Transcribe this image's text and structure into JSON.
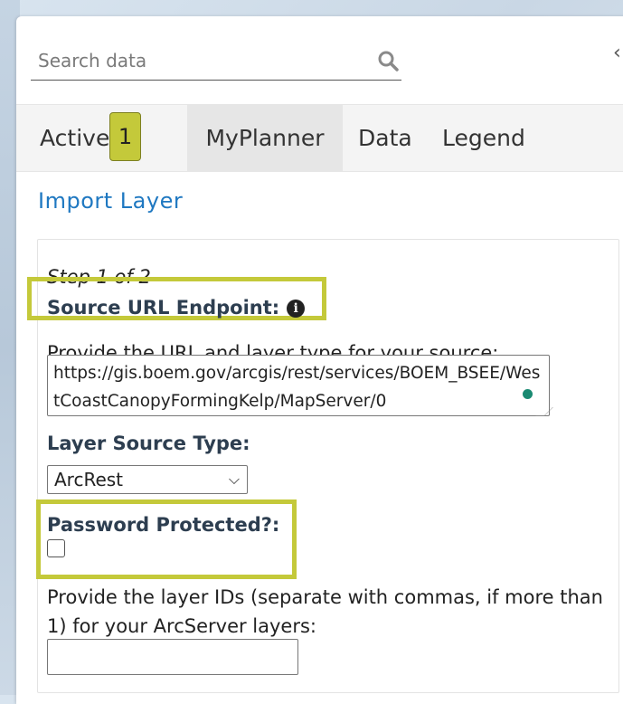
{
  "search": {
    "placeholder": "Search data"
  },
  "tabs": {
    "active_label": "Active",
    "active_separator": "•",
    "active_count": "1",
    "myplanner": "MyPlanner",
    "data": "Data",
    "legend": "Legend"
  },
  "import": {
    "title": "Import Layer",
    "step": "Step 1 of 2",
    "source_label": "Source URL Endpoint:",
    "source_help": "Provide the URL and layer type for your source:",
    "url_value": "https://gis.boem.gov/arcgis/rest/services/BOEM_BSEE/WestCoastCanopyFormingKelp/MapServer/0",
    "layer_type_label": "Layer Source Type:",
    "layer_type_value": "ArcRest",
    "password_label": "Password Protected?:",
    "password_checked": false,
    "layer_ids_help": "Provide the layer IDs (separate with commas, if more than 1) for your ArcServer layers:",
    "layer_ids_value": ""
  },
  "colors": {
    "accent": "#1f78c1",
    "highlight": "#c4c93a",
    "status_dot": "#1a8a72"
  },
  "icons": {
    "search": "search-icon",
    "info": "info-icon",
    "collapse": "collapse-panel-icon"
  }
}
